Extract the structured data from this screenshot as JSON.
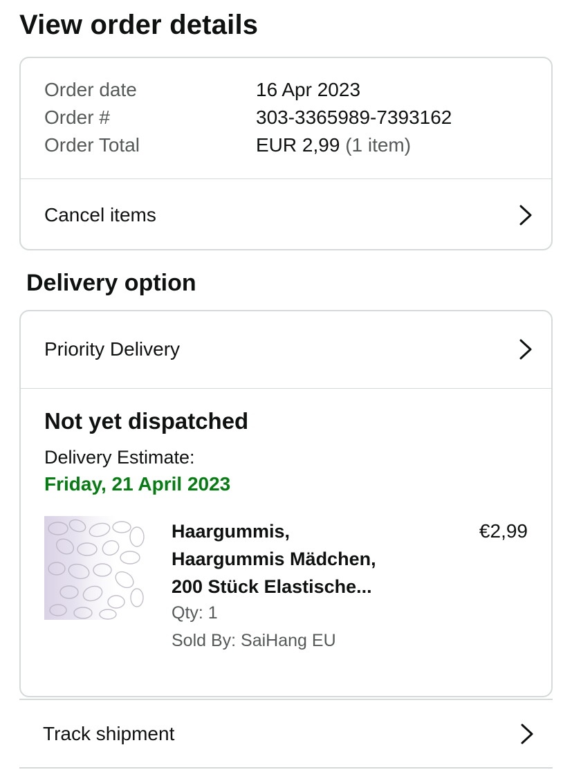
{
  "page": {
    "title": "View order details"
  },
  "order_summary": {
    "date_label": "Order date",
    "date_value": "16 Apr 2023",
    "number_label": "Order #",
    "number_value": "303-3365989-7393162",
    "total_label": "Order Total",
    "total_value": "EUR 2,99",
    "total_items": "(1 item)"
  },
  "cancel": {
    "label": "Cancel items"
  },
  "delivery": {
    "section_title": "Delivery option",
    "option_label": "Priority Delivery",
    "status": "Not yet dispatched",
    "estimate_label": "Delivery Estimate:",
    "estimate_date": "Friday, 21 April 2023",
    "estimate_color": "#067d12"
  },
  "product": {
    "title_line1": "Haargummis,",
    "title_line2": "Haargummis Mädchen,",
    "title_line3": "200 Stück Elastische...",
    "price": "€2,99",
    "qty": "Qty: 1",
    "seller": "Sold By: SaiHang EU",
    "image_icon": "hair-ties-thumbnail"
  },
  "track": {
    "label": "Track shipment"
  },
  "colors": {
    "border": "#d5d9d9",
    "text": "#0f1111",
    "muted": "#565959"
  }
}
